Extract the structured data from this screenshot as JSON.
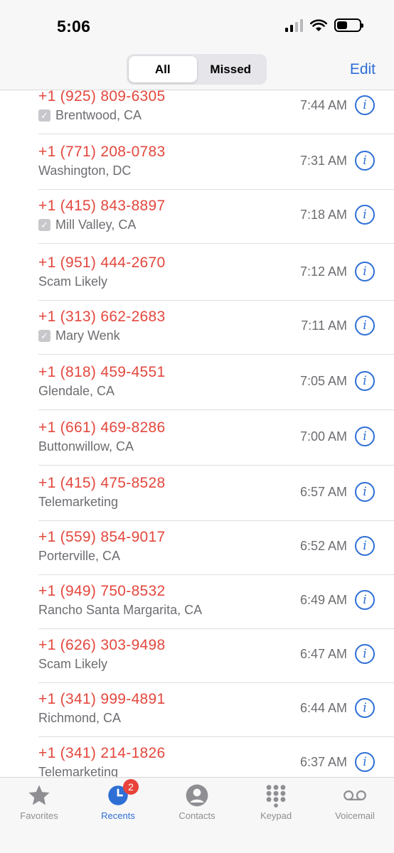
{
  "status": {
    "time": "5:06",
    "battery_level": 0.45
  },
  "header": {
    "segments": [
      {
        "label": "All",
        "active": true
      },
      {
        "label": "Missed",
        "active": false
      }
    ],
    "edit_label": "Edit"
  },
  "calls": [
    {
      "number": "+1 (925) 809-6305",
      "subtitle": "Brentwood, CA",
      "verified": true,
      "time": "7:44 AM"
    },
    {
      "number": "+1 (771) 208-0783",
      "subtitle": "Washington, DC",
      "verified": false,
      "time": "7:31 AM"
    },
    {
      "number": "+1 (415) 843-8897",
      "subtitle": "Mill Valley, CA",
      "verified": true,
      "time": "7:18 AM"
    },
    {
      "number": "+1 (951) 444-2670",
      "subtitle": "Scam Likely",
      "verified": false,
      "time": "7:12 AM"
    },
    {
      "number": "+1 (313) 662-2683",
      "subtitle": "Mary Wenk",
      "verified": true,
      "time": "7:11 AM"
    },
    {
      "number": "+1 (818) 459-4551",
      "subtitle": "Glendale, CA",
      "verified": false,
      "time": "7:05 AM"
    },
    {
      "number": "+1 (661) 469-8286",
      "subtitle": "Buttonwillow, CA",
      "verified": false,
      "time": "7:00 AM"
    },
    {
      "number": "+1 (415) 475-8528",
      "subtitle": "Telemarketing",
      "verified": false,
      "time": "6:57 AM"
    },
    {
      "number": "+1 (559) 854-9017",
      "subtitle": "Porterville, CA",
      "verified": false,
      "time": "6:52 AM"
    },
    {
      "number": "+1 (949) 750-8532",
      "subtitle": "Rancho Santa Margarita, CA",
      "verified": false,
      "time": "6:49 AM"
    },
    {
      "number": "+1 (626) 303-9498",
      "subtitle": "Scam Likely",
      "verified": false,
      "time": "6:47 AM"
    },
    {
      "number": "+1 (341) 999-4891",
      "subtitle": "Richmond, CA",
      "verified": false,
      "time": "6:44 AM"
    },
    {
      "number": "+1 (341) 214-1826",
      "subtitle": "Telemarketing",
      "verified": false,
      "time": "6:37 AM"
    }
  ],
  "tabbar": {
    "tabs": [
      {
        "label": "Favorites",
        "icon": "star-icon",
        "active": false
      },
      {
        "label": "Recents",
        "icon": "clock-icon",
        "active": true,
        "badge": "2"
      },
      {
        "label": "Contacts",
        "icon": "person-icon",
        "active": false
      },
      {
        "label": "Keypad",
        "icon": "keypad-icon",
        "active": false
      },
      {
        "label": "Voicemail",
        "icon": "voicemail-icon",
        "active": false
      }
    ]
  },
  "colors": {
    "accent": "#2e6fd6",
    "missed": "#e3483e",
    "badge": "#e8433a"
  }
}
